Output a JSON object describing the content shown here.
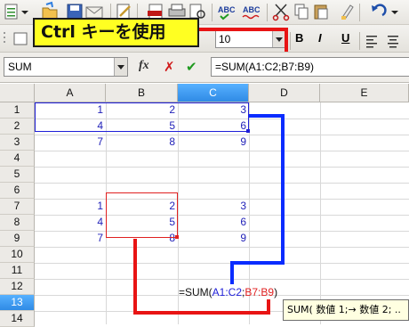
{
  "caption": {
    "text": "Ctrl キーを使用"
  },
  "toolbar": {
    "font_size_value": "10",
    "bold_label": "B",
    "italic_label": "I",
    "underline_label": "U",
    "icons": [
      "new-document-icon",
      "dropdown-arrow-icon",
      "open-folder-icon",
      "save-icon",
      "email-icon",
      "edit-file-icon",
      "export-pdf-icon",
      "print-icon",
      "print-preview-icon",
      "spellcheck-icon",
      "autospellcheck-icon",
      "cut-icon",
      "copy-icon",
      "paste-icon",
      "clone-formatting-icon",
      "undo-icon",
      "undo-dropdown-icon",
      "styles-icon",
      "align-left-icon",
      "align-center-icon"
    ]
  },
  "formula_bar": {
    "name_box": "SUM",
    "fx_label": "fx",
    "sigma_symbol": "✗",
    "check_symbol": "✔",
    "equal_symbol": "=",
    "formula": "=SUM(A1:C2;B7:B9)"
  },
  "grid": {
    "columns": [
      "A",
      "B",
      "C",
      "D",
      "E"
    ],
    "selected_column": "C",
    "rows": [
      "1",
      "2",
      "3",
      "4",
      "5",
      "6",
      "7",
      "8",
      "9",
      "10",
      "11",
      "12",
      "13",
      "14"
    ],
    "selected_row": "13",
    "cells": {
      "r1": [
        "1",
        "2",
        "3"
      ],
      "r2": [
        "4",
        "5",
        "6"
      ],
      "r3": [
        "7",
        "8",
        "9"
      ],
      "r7": [
        "1",
        "2",
        "3"
      ],
      "r8": [
        "4",
        "5",
        "6"
      ],
      "r9": [
        "7",
        "8",
        "9"
      ]
    },
    "editing_cell": {
      "prefix": "=SUM(",
      "ref1": "A1:C2",
      "sep": ";",
      "ref2": "B7:B9",
      "suffix": ")"
    }
  },
  "tooltip": {
    "text": "SUM( 数値 1;→ 数値 2; .."
  },
  "colors": {
    "ref1": "#2020d8",
    "ref2": "#e02020",
    "annotation_blue": "#0a2cff",
    "annotation_red": "#e81414",
    "caption_bg": "#ffff22",
    "selection": "#3a95f0"
  }
}
